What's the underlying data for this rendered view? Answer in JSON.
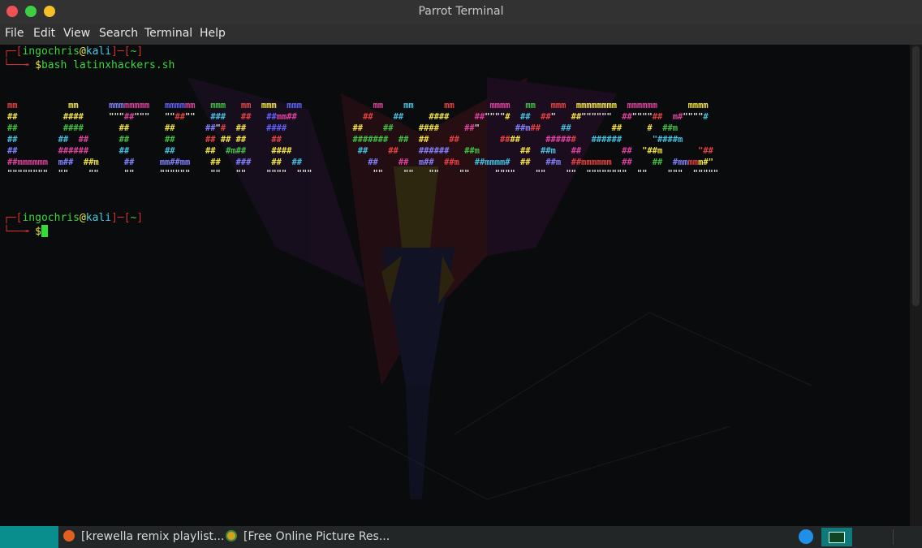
{
  "window": {
    "title": "Parrot Terminal"
  },
  "menubar": {
    "items": [
      "File",
      "Edit",
      "View",
      "Search",
      "Terminal",
      "Help"
    ]
  },
  "terminal": {
    "user": "ingochris",
    "at": "@",
    "host": "kali",
    "dir": "~",
    "command": "bash latinxhackers.sh",
    "prompt_symbol": "$",
    "art_text": "LATINX HACKERS"
  },
  "taskbar": {
    "tasks": [
      "[krewella remix playlist...",
      "[Free Online Picture Res..."
    ]
  },
  "colors": {
    "prompt_red": "#d23030",
    "prompt_green": "#3fd43f",
    "host_yellow": "#e8e84a",
    "start_teal": "#0a8d8d"
  }
}
